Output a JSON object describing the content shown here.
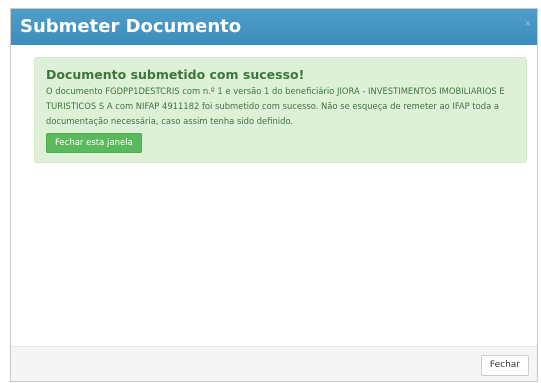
{
  "modal": {
    "title": "Submeter Documento",
    "close_glyph": "×"
  },
  "alert": {
    "title": "Documento submetido com sucesso!",
    "message": "O documento FGDPP1DESTCRIS com n.º 1 e versão 1 do beneficiário JIORA - INVESTIMENTOS IMOBILIARIOS E TURISTICOS S A com NIFAP 4911182 foi submetido com sucesso. Não se esqueça de remeter ao IFAP toda a documentação necessária, caso assim tenha sido definido.",
    "button_label": "Fechar esta janela"
  },
  "footer": {
    "close_label": "Fechar"
  },
  "colors": {
    "header": "#3d8dbd",
    "alert_bg": "#dff0d8",
    "alert_text": "#3c763d",
    "success_button": "#5cb85c"
  },
  "icons": {
    "close": "close-icon"
  }
}
